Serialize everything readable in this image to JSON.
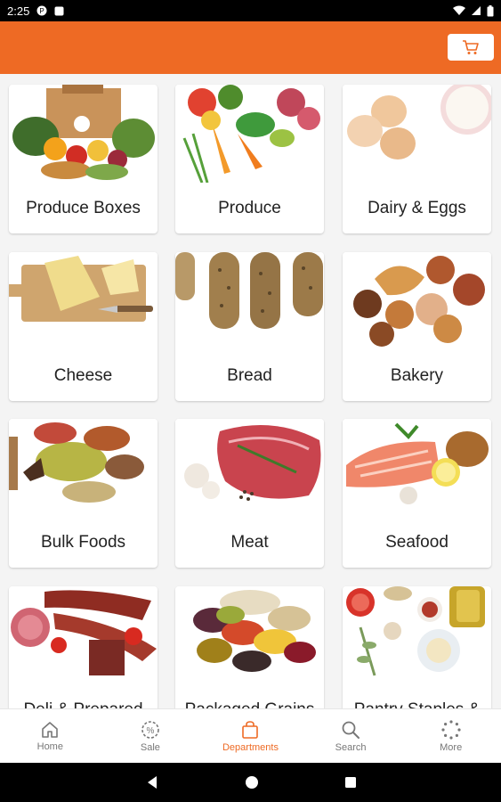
{
  "status_bar": {
    "time": "2:25"
  },
  "app_bar": {
    "cart_icon": "cart-icon"
  },
  "categories": [
    {
      "label": "Produce Boxes"
    },
    {
      "label": "Produce"
    },
    {
      "label": "Dairy & Eggs"
    },
    {
      "label": "Cheese"
    },
    {
      "label": "Bread"
    },
    {
      "label": "Bakery"
    },
    {
      "label": "Bulk Foods"
    },
    {
      "label": "Meat"
    },
    {
      "label": "Seafood"
    },
    {
      "label": "Deli & Prepared"
    },
    {
      "label": "Packaged Grains"
    },
    {
      "label": "Pantry Staples &"
    }
  ],
  "bottom_nav": {
    "items": [
      {
        "label": "Home",
        "icon": "home-icon"
      },
      {
        "label": "Sale",
        "icon": "sale-icon"
      },
      {
        "label": "Departments",
        "icon": "bag-icon",
        "active": true
      },
      {
        "label": "Search",
        "icon": "search-icon"
      },
      {
        "label": "More",
        "icon": "more-icon"
      }
    ]
  },
  "colors": {
    "accent": "#ee6a24",
    "text": "#222222",
    "nav_inactive": "#777777"
  }
}
